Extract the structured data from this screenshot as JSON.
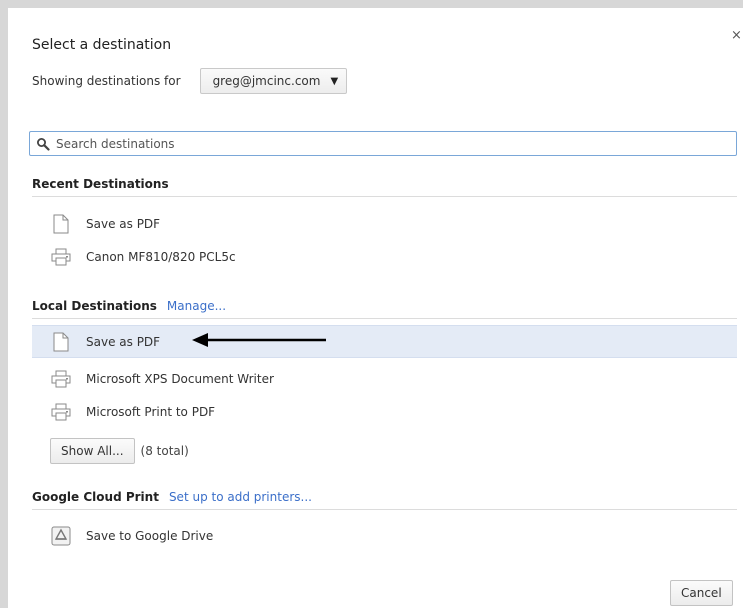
{
  "dialog": {
    "title": "Select a destination",
    "close_symbol": "×",
    "showing_label": "Showing destinations for",
    "account": "greg@jmcinc.com",
    "search_placeholder": "Search destinations"
  },
  "recent": {
    "title": "Recent Destinations",
    "items": [
      {
        "label": "Save as PDF",
        "icon": "document-icon"
      },
      {
        "label": "Canon MF810/820 PCL5c",
        "icon": "printer-icon"
      }
    ]
  },
  "local": {
    "title": "Local Destinations",
    "link": "Manage...",
    "items": [
      {
        "label": "Save as PDF",
        "icon": "document-icon",
        "selected": true
      },
      {
        "label": "Microsoft XPS Document Writer",
        "icon": "printer-icon"
      },
      {
        "label": "Microsoft Print to PDF",
        "icon": "printer-icon"
      }
    ],
    "show_all_label": "Show All...",
    "total_note": "(8 total)"
  },
  "cloud": {
    "title": "Google Cloud Print",
    "link": "Set up to add printers...",
    "items": [
      {
        "label": "Save to Google Drive",
        "icon": "google-drive-icon"
      }
    ]
  },
  "footer": {
    "cancel_label": "Cancel"
  },
  "colors": {
    "link": "#3b6fc9",
    "selected_row": "#e4ebf6",
    "search_border": "#7aa7d8"
  }
}
